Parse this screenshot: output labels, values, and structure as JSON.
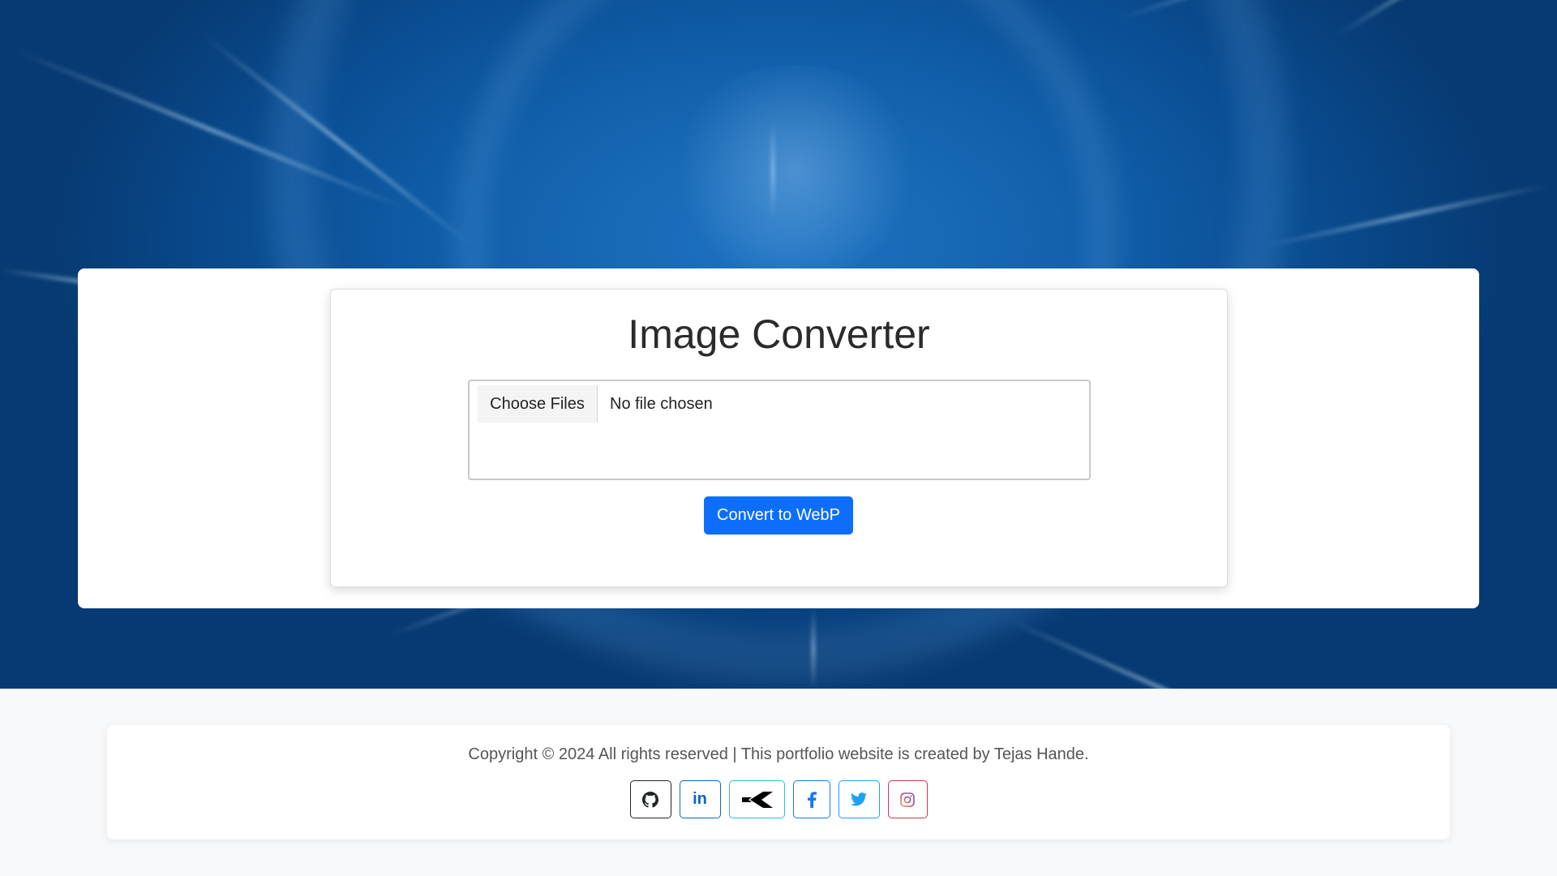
{
  "page": {
    "title": "Image Converter"
  },
  "converter": {
    "file_button_label": "Choose Files",
    "file_status": "No file chosen",
    "convert_label": "Convert to WebP",
    "accent_color": "#0d6efd"
  },
  "footer": {
    "copyright": "Copyright © 2024 All rights reserved | This portfolio website is created by Tejas Hande.",
    "socials": [
      {
        "name": "github",
        "icon": "github-icon",
        "color": "#212529"
      },
      {
        "name": "linkedin",
        "icon": "linkedin-icon",
        "label": "in",
        "color": "#0a66c2"
      },
      {
        "name": "kaggle",
        "icon": "kaggle-icon",
        "color": "#20c2d6"
      },
      {
        "name": "facebook",
        "icon": "facebook-icon",
        "color": "#1877f2"
      },
      {
        "name": "twitter",
        "icon": "twitter-icon",
        "color": "#1da1f2"
      },
      {
        "name": "instagram",
        "icon": "instagram-icon",
        "color": "#c23a4e"
      }
    ]
  }
}
